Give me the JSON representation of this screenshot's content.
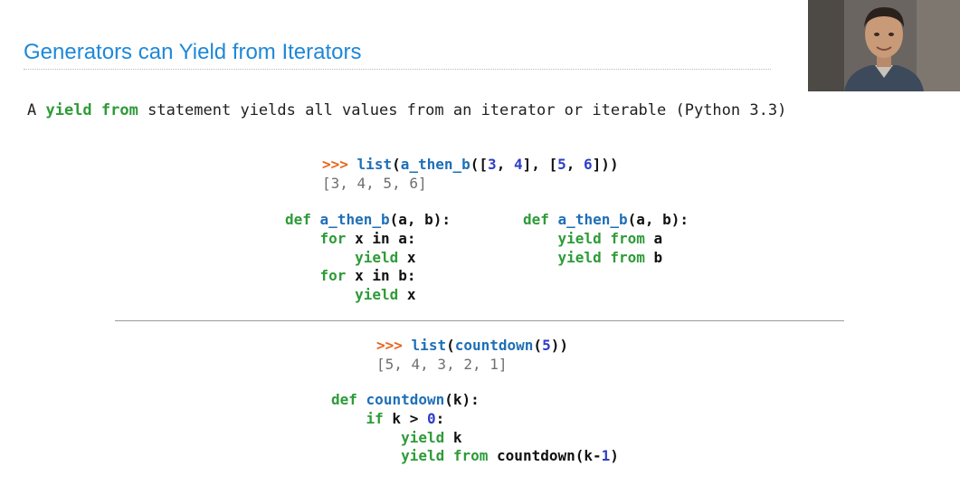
{
  "slide": {
    "title": "Generators can Yield from Iterators",
    "intro": {
      "prefix": "A ",
      "kw1": "yield",
      "sp": " ",
      "kw2": "from",
      "suffix": " statement yields all values from an iterator or iterable (Python 3.3)"
    }
  },
  "example1": {
    "prompt": ">>>",
    "call_fn": "list",
    "call_lp": "(",
    "call_inner_fn": "a_then_b",
    "call_args_open": "([",
    "n3": "3",
    "comma1": ", ",
    "n4": "4",
    "mid": "], [",
    "n5": "5",
    "comma2": ", ",
    "n6": "6",
    "close": "]))",
    "output": "[3, 4, 5, 6]"
  },
  "left_code": {
    "def": "def",
    "fname": "a_then_b",
    "sig": "(a, b):",
    "for1": "for",
    "for1_rest": " x in a:",
    "yield1": "yield",
    "yield1_rest": " x",
    "for2": "for",
    "for2_rest": " x in b:",
    "yield2": "yield",
    "yield2_rest": " x"
  },
  "right_code": {
    "def": "def",
    "fname": "a_then_b",
    "sig": "(a, b):",
    "yield1": "yield",
    "from1": "from",
    "var1": " a",
    "yield2": "yield",
    "from2": "from",
    "var2": " b"
  },
  "example2": {
    "prompt": ">>>",
    "call_fn": "list",
    "call_lp": "(",
    "call_inner_fn": "countdown",
    "call_lp2": "(",
    "n5": "5",
    "close": "))",
    "output": "[5, 4, 3, 2, 1]"
  },
  "countdown_code": {
    "def": "def",
    "fname": "countdown",
    "sig": "(k):",
    "if": "if",
    "cond": " k > ",
    "zero": "0",
    "colon": ":",
    "yield1": "yield",
    "yield1_rest": " k",
    "yield2": "yield",
    "from": "from",
    "call": " countdown(k-",
    "one": "1",
    "close": ")"
  }
}
